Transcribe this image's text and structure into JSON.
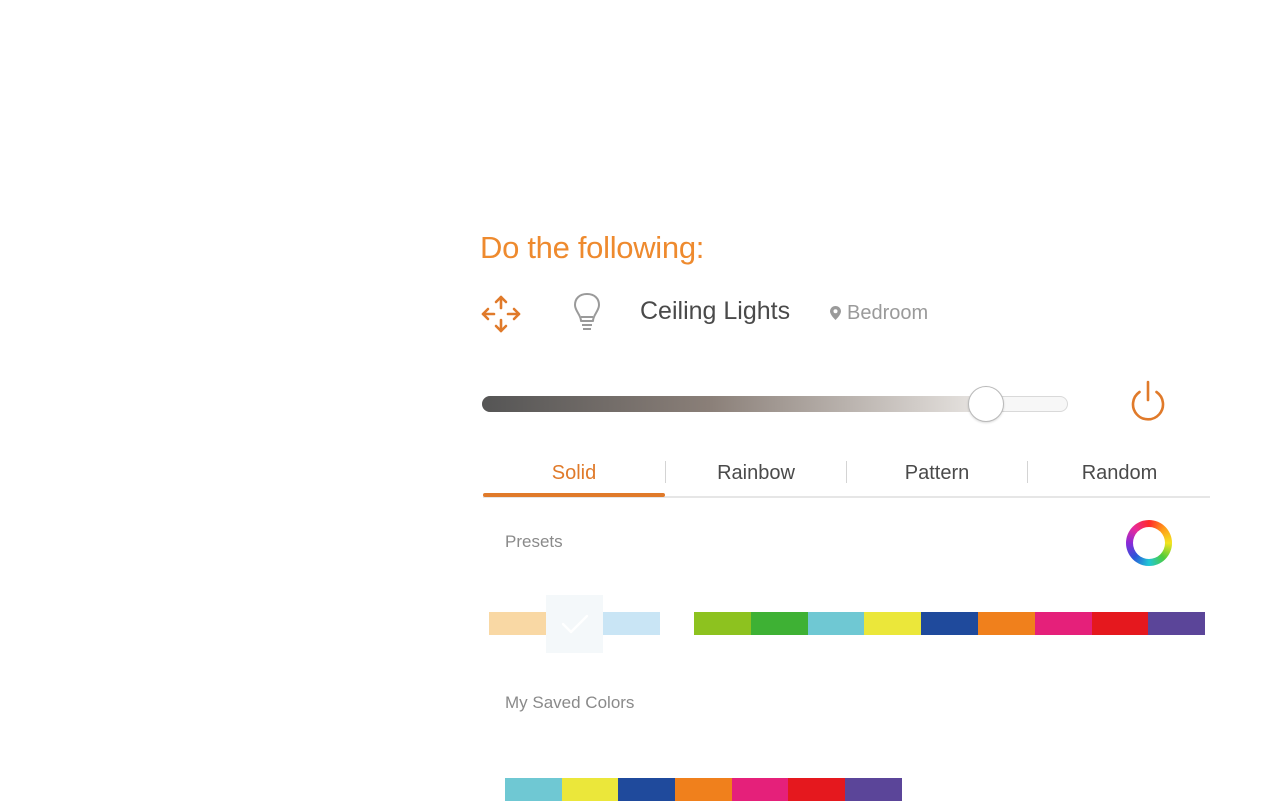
{
  "heading": "Do the following:",
  "device": {
    "name": "Ceiling Lights",
    "location": "Bedroom",
    "icons": [
      "move-arrows-icon",
      "light-bulb-icon",
      "location-pin-icon",
      "power-icon"
    ]
  },
  "brightness": {
    "level_percent": 86
  },
  "tabs": [
    {
      "label": "Solid",
      "active": true
    },
    {
      "label": "Rainbow",
      "active": false
    },
    {
      "label": "Pattern",
      "active": false
    },
    {
      "label": "Random",
      "active": false
    }
  ],
  "presets": {
    "label": "Presets",
    "warm_colors": [
      "#f9d8a4",
      "#f4f8fa",
      "#c9e5f5"
    ],
    "selected_index": 1,
    "colors": [
      "#8dc21f",
      "#3eb134",
      "#6fc8d3",
      "#ebe73a",
      "#1f4a9c",
      "#f0801c",
      "#e5207a",
      "#e5181e",
      "#5b4599"
    ]
  },
  "saved": {
    "label": "My Saved Colors",
    "colors": [
      "#6fc8d3",
      "#ebe73a",
      "#1f4a9c",
      "#f0801c",
      "#e5207a",
      "#e5181e",
      "#5b4599"
    ]
  },
  "theme": {
    "accent": "#e07a2a",
    "heading_color": "#ee8a2e"
  }
}
